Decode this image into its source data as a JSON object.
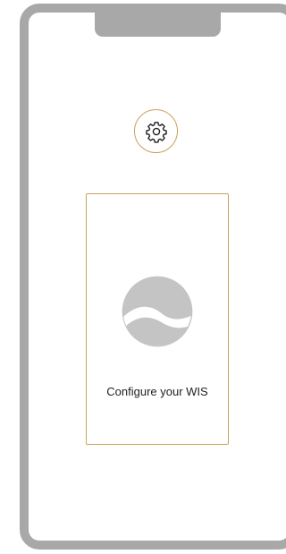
{
  "config_card": {
    "label": "Configure your WIS"
  },
  "settings": {
    "icon": "gear-icon"
  },
  "logo": {
    "icon": "water-wave-logo"
  },
  "colors": {
    "frame": "#a8a8a8",
    "accent": "#c9a25a",
    "logo": "#c4c4c4"
  }
}
